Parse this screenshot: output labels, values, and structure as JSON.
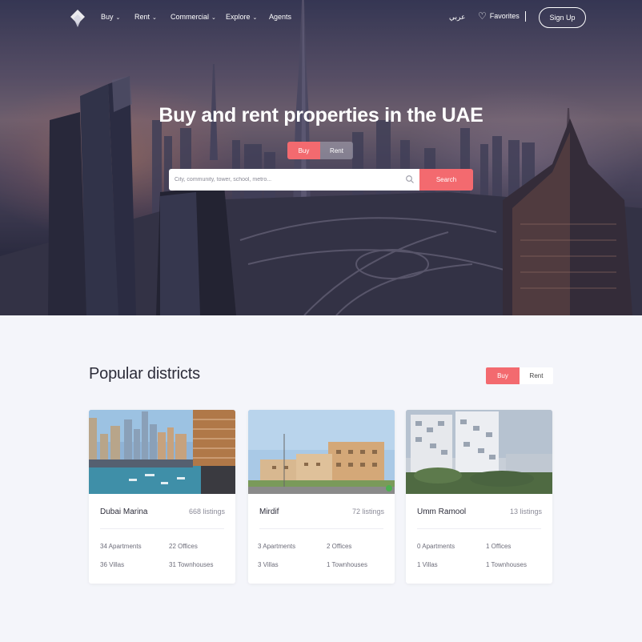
{
  "nav": {
    "items": [
      {
        "label": "Buy",
        "dropdown": true
      },
      {
        "label": "Rent",
        "dropdown": true
      },
      {
        "label": "Commercial",
        "dropdown": true
      },
      {
        "label": "Explore",
        "dropdown": true
      },
      {
        "label": "Agents",
        "dropdown": false
      }
    ],
    "language": "عربي",
    "favorites": "Favorites",
    "signup": "Sign Up"
  },
  "hero": {
    "title": "Buy and rent properties in the UAE",
    "toggle": {
      "buy": "Buy",
      "rent": "Rent",
      "active": "buy"
    },
    "search_placeholder": "City, community, tower, school, metro...",
    "search_button": "Search"
  },
  "districts": {
    "title": "Popular districts",
    "toggle": {
      "buy": "Buy",
      "rent": "Rent",
      "active": "buy"
    },
    "cards": [
      {
        "name": "Dubai Marina",
        "listings": "668 listings",
        "stats": [
          "34 Apartments",
          "22 Offices",
          "36 Villas",
          "31 Townhouses"
        ]
      },
      {
        "name": "Mirdif",
        "listings": "72 listings",
        "stats": [
          "3 Apartments",
          "2 Offices",
          "3 Villas",
          "1 Townhouses"
        ]
      },
      {
        "name": "Umm Ramool",
        "listings": "13 listings",
        "stats": [
          "0 Apartments",
          "1 Offices",
          "1 Villas",
          "1 Townhouses"
        ]
      }
    ]
  },
  "colors": {
    "accent": "#f36a6f",
    "page_bg": "#f4f5fa",
    "title_text": "#2d2d3a"
  },
  "icons": [
    "logo-icon",
    "chevron-down-icon",
    "heart-icon",
    "search-icon"
  ]
}
